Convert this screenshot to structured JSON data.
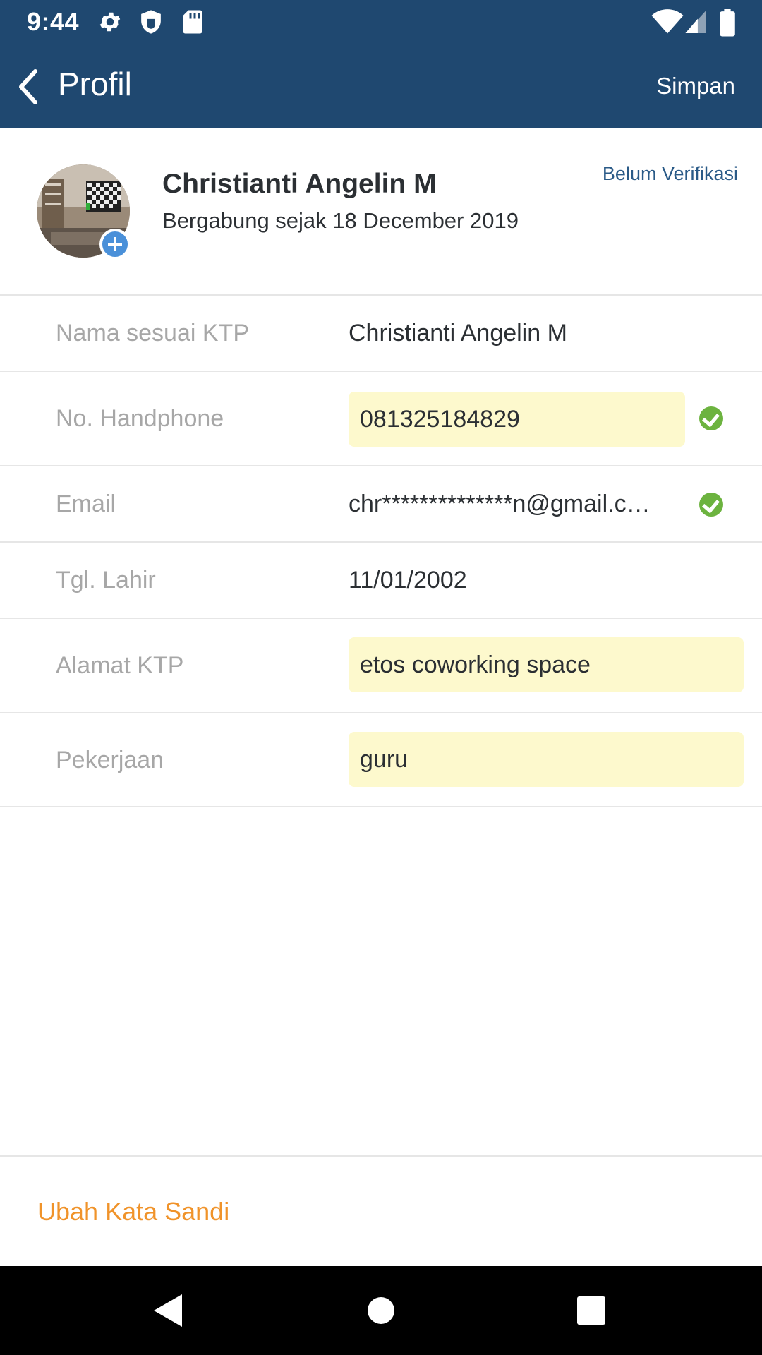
{
  "status_bar": {
    "time": "9:44",
    "left_icons": [
      "gear-icon",
      "shield-icon",
      "sd-card-icon"
    ],
    "right_icons": [
      "wifi-icon",
      "cellular-signal-icon",
      "battery-icon"
    ]
  },
  "app_bar": {
    "title": "Profil",
    "action_label": "Simpan",
    "back_icon": "chevron-left-icon"
  },
  "profile": {
    "name": "Christianti Angelin M",
    "joined": "Bergabung sejak 18 December 2019",
    "verification_status": "Belum Verifikasi"
  },
  "fields": [
    {
      "label": "Nama sesuai KTP",
      "value": "Christianti Angelin M"
    },
    {
      "label": "No. Handphone",
      "value": "081325184829",
      "verified": true
    },
    {
      "label": "Email",
      "value": "chr**************n@gmail.c…",
      "verified": true
    },
    {
      "label": "Tgl. Lahir",
      "value": "11/01/2002"
    },
    {
      "label": "Alamat KTP",
      "value": "etos coworking space"
    },
    {
      "label": "Pekerjaan",
      "value": "guru"
    }
  ],
  "actions": {
    "change_password": "Ubah Kata Sandi"
  },
  "colors": {
    "primary": "#1f4870",
    "editable_field_bg": "#fdf9cd",
    "verified_green": "#6cb33f",
    "accent_orange": "#f0932a",
    "label_gray": "#a7a7a7",
    "avatar_badge_blue": "#4a90d9"
  }
}
